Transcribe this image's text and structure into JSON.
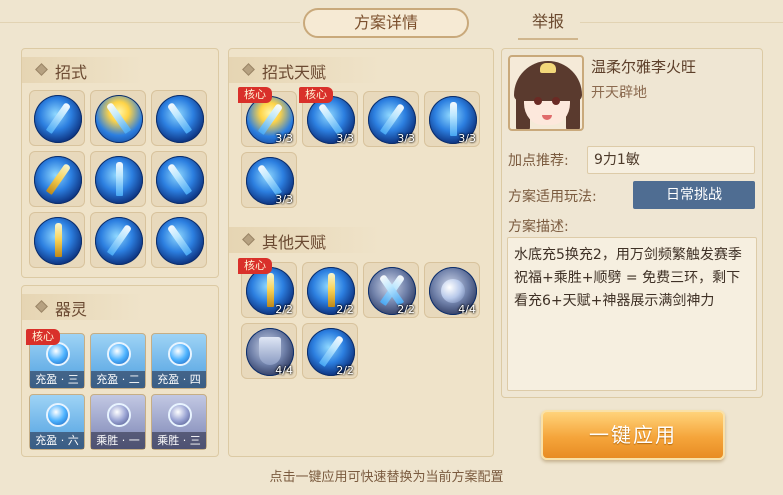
{
  "tabs": {
    "detail": "方案详情",
    "report": "举报"
  },
  "panels": {
    "skills": {
      "title": "招式"
    },
    "skill_talents": {
      "title": "招式天赋"
    },
    "other_talents": {
      "title": "其他天赋"
    },
    "spirits": {
      "title": "器灵"
    }
  },
  "badges": {
    "core": "核心"
  },
  "skill_talents": [
    {
      "count": "3/3",
      "core": true
    },
    {
      "count": "3/3",
      "core": true
    },
    {
      "count": "3/3",
      "core": false
    },
    {
      "count": "3/3",
      "core": false
    },
    {
      "count": "3/3",
      "core": false
    }
  ],
  "other_talents": [
    {
      "count": "2/2",
      "core": true
    },
    {
      "count": "2/2",
      "core": false
    },
    {
      "count": "2/2",
      "core": false
    },
    {
      "count": "4/4",
      "core": false
    },
    {
      "count": "4/4",
      "core": false
    },
    {
      "count": "2/2",
      "core": false
    }
  ],
  "spirits": [
    {
      "label": "充盈 · 三",
      "core": true
    },
    {
      "label": "充盈 · 二",
      "core": false
    },
    {
      "label": "充盈 · 四",
      "core": false
    },
    {
      "label": "充盈 · 六",
      "core": false
    },
    {
      "label": "乘胜 · 一",
      "core": false
    },
    {
      "label": "乘胜 · 三",
      "core": false
    }
  ],
  "character": {
    "name": "温柔尔雅李火旺",
    "title": "开天辟地"
  },
  "fields": {
    "points_label": "加点推荐:",
    "points_value": "9力1敏",
    "mode_label": "方案适用玩法:",
    "mode_value": "日常挑战",
    "desc_label": "方案描述:",
    "desc_value": "水底充5换充2，用万剑频繁触发赛季祝福+乘胜+顺劈 = 免费三环，剩下看充6+天赋+神器展示满剑神力"
  },
  "apply_button": "一键应用",
  "hint": "点击一键应用可快速替换为当前方案配置",
  "colors": {
    "accent": "#f5a53b",
    "mode_button": "#4f6d92",
    "core_badge": "#d9302a"
  }
}
